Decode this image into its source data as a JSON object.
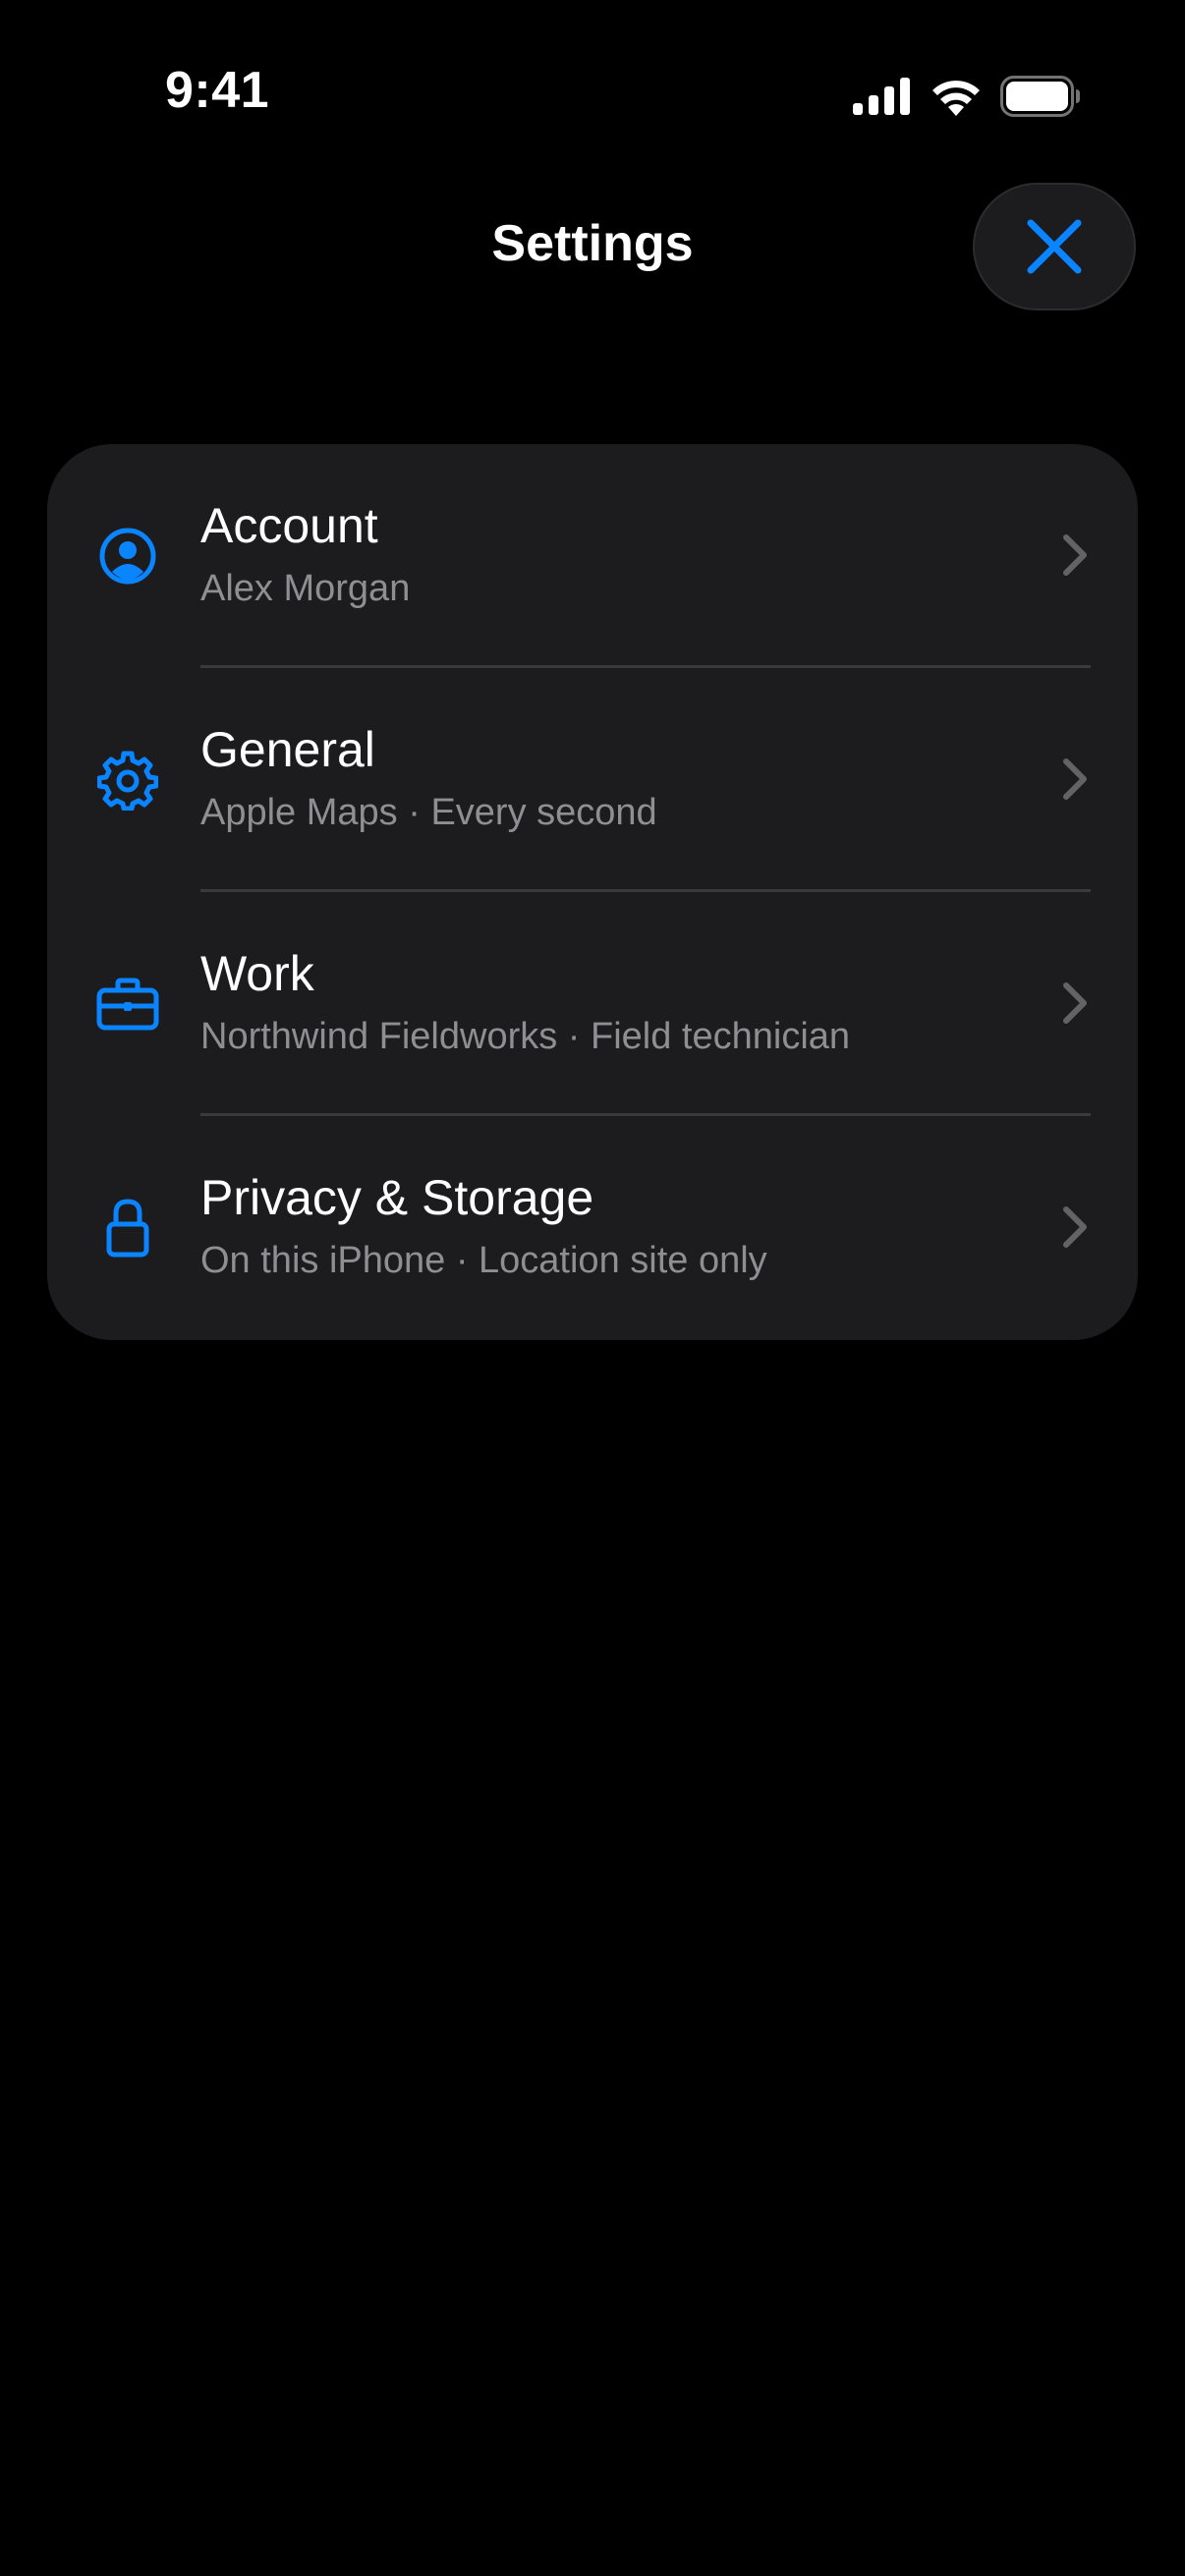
{
  "status_bar": {
    "time": "9:41",
    "icons": [
      "cellular-signal-icon",
      "wifi-icon",
      "battery-icon"
    ]
  },
  "nav": {
    "title": "Settings",
    "close_icon": "close-icon"
  },
  "colors": {
    "accent": "#0a84ff",
    "background": "#000000",
    "card": "#1c1c1e",
    "secondary_text": "#8e8e93",
    "separator": "#3a3a3c",
    "chevron": "#636366"
  },
  "settings": {
    "rows": [
      {
        "title": "Account",
        "subtitle": "Alex Morgan",
        "icon": "person-circle-icon"
      },
      {
        "title": "General",
        "subtitle": "Apple Maps · Every second",
        "icon": "gear-icon"
      },
      {
        "title": "Work",
        "subtitle": "Northwind Fieldworks · Field technician",
        "icon": "briefcase-icon"
      },
      {
        "title": "Privacy & Storage",
        "subtitle": "On this iPhone · Location site only",
        "icon": "lock-icon"
      }
    ]
  }
}
